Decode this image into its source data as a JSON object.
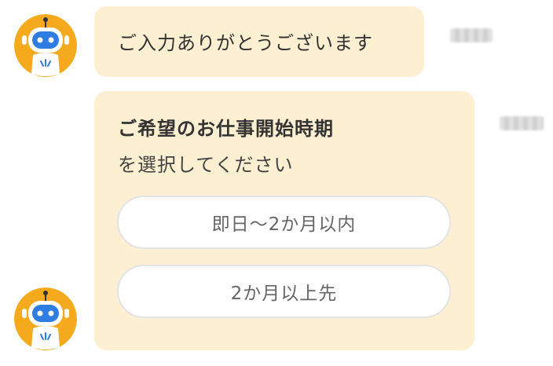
{
  "messages": [
    {
      "text": "ご入力ありがとうございます",
      "timestamp": ""
    },
    {
      "title": "ご希望のお仕事開始時期",
      "subtitle": "を選択してください",
      "timestamp": "",
      "options": [
        {
          "label": "即日〜2か月以内"
        },
        {
          "label": "2か月以上先"
        }
      ]
    }
  ],
  "avatar": {
    "icon": "robot-icon",
    "background": "#f5a91c",
    "head_color": "#ffffff",
    "face_color": "#2f7de1"
  },
  "colors": {
    "bubble": "#fdefd1",
    "text": "#333333",
    "option_text": "#666666",
    "option_border": "#e3e3e3"
  }
}
